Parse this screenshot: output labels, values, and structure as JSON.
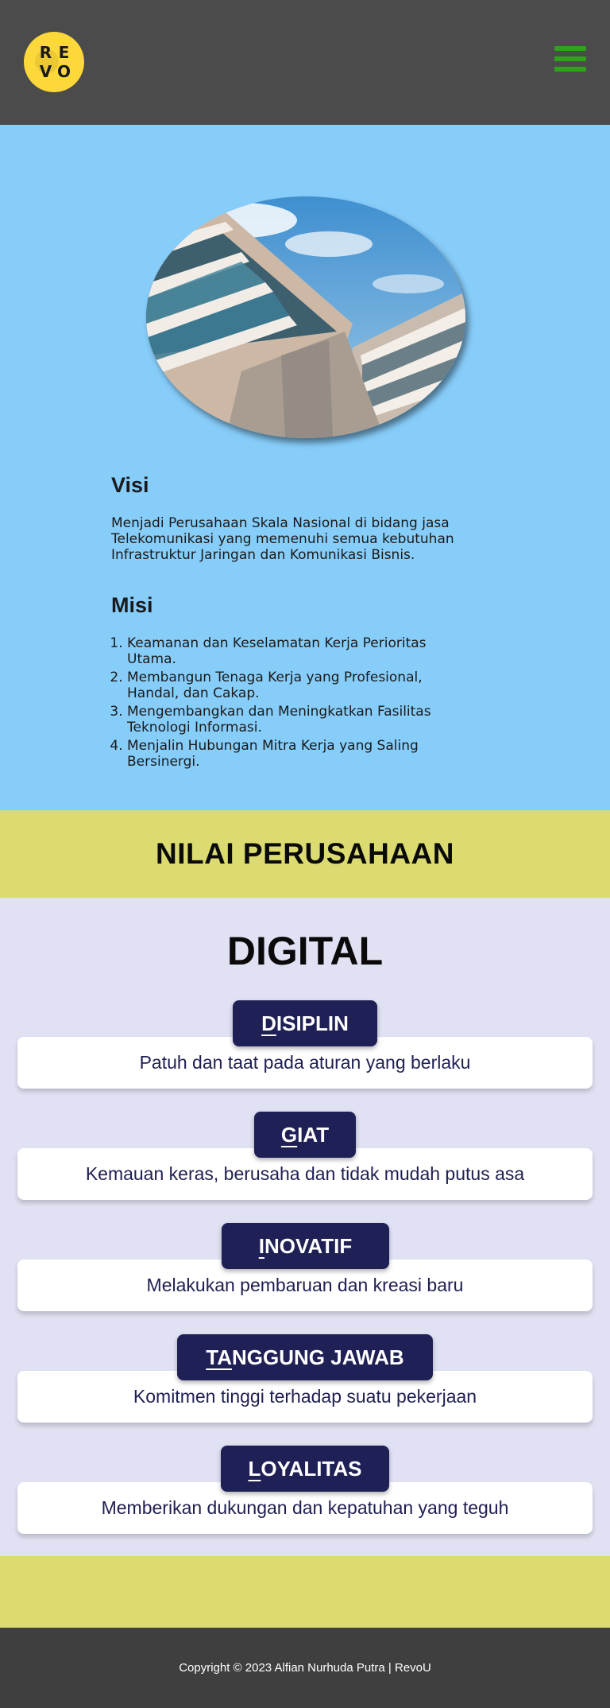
{
  "header": {
    "logo_letters": [
      "R",
      "E",
      "V",
      "O"
    ],
    "menu_icon": "hamburger-menu-icon",
    "colors": {
      "background": "#4b4b4b",
      "logo": "#fcd83a",
      "menu": "#2ea21b"
    }
  },
  "hero": {
    "image": "building-photo",
    "visi_title": "Visi",
    "visi_text": "Menjadi Perusahaan Skala Nasional di bidang jasa Telekomunikasi yang memenuhi semua kebutuhan Infrastruktur Jaringan dan Komunikasi Bisnis.",
    "misi_title": "Misi",
    "misi_items": [
      "Keamanan dan Keselamatan Kerja Perioritas Utama.",
      "Membangun Tenaga Kerja yang Profesional, Handal, dan Cakap.",
      "Mengembangkan dan Meningkatkan Fasilitas Teknologi Informasi.",
      "Menjalin Hubungan Mitra Kerja yang Saling Bersinergi."
    ]
  },
  "nilai": {
    "title": "NILAI PERUSAHAAN"
  },
  "values": {
    "acronym": "DIGITAL",
    "items": [
      {
        "first": "D",
        "rest": "ISIPLIN",
        "desc": "Patuh dan taat pada aturan yang berlaku"
      },
      {
        "first": "G",
        "rest": "IAT",
        "desc": "Kemauan keras, berusaha dan tidak mudah putus asa"
      },
      {
        "first": "I",
        "rest": "NOVATIF",
        "desc": "Melakukan pembaruan dan kreasi baru"
      },
      {
        "first": "TA",
        "rest": "NGGUNG JAWAB",
        "desc": "Komitmen tinggi terhadap suatu pekerjaan"
      },
      {
        "first": "L",
        "rest": "OYALITAS",
        "desc": "Memberikan dukungan dan kepatuhan yang teguh"
      }
    ]
  },
  "footer": {
    "copyright": "Copyright © 2023 Alfian Nurhuda Putra | RevoU"
  }
}
